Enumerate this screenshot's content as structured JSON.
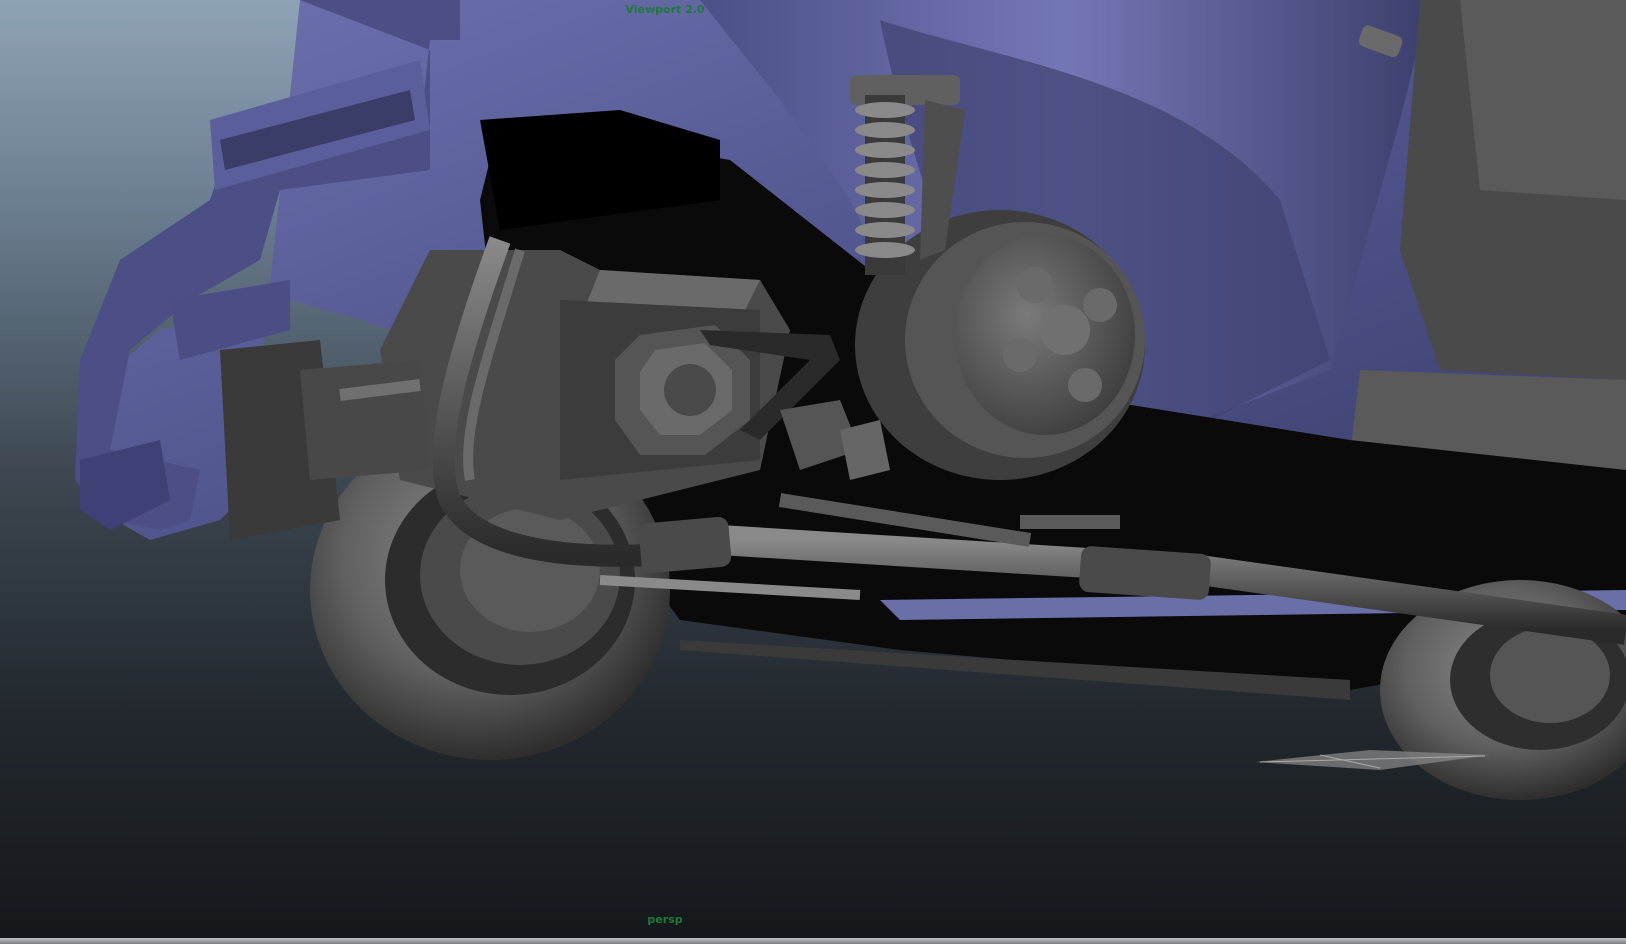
{
  "viewport": {
    "title": "Viewport 2.0",
    "camera": "persp"
  },
  "colors": {
    "body_paint": "#5a5f9c",
    "chassis_gray": "#555555",
    "shadow": "#000000",
    "hud_text": "#1f7a3a"
  }
}
